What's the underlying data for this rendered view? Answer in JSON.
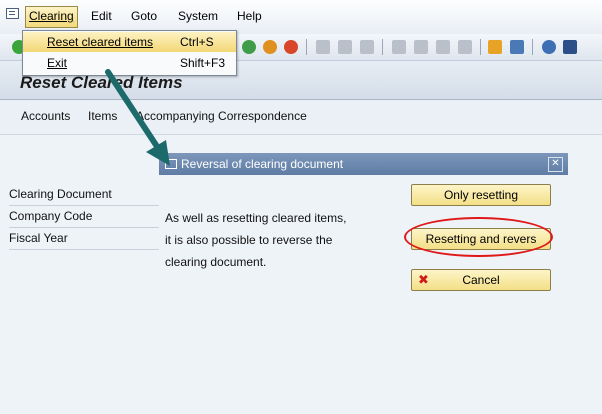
{
  "menubar": {
    "items": [
      {
        "label": "Clearing",
        "active": true
      },
      {
        "label": "Edit"
      },
      {
        "label": "Goto"
      },
      {
        "label": "System"
      },
      {
        "label": "Help"
      }
    ]
  },
  "dropdown": {
    "items": [
      {
        "label": "Reset cleared items",
        "shortcut": "Ctrl+S"
      },
      {
        "label": "Exit",
        "shortcut": "Shift+F3"
      }
    ]
  },
  "page": {
    "title": "Reset Cleared Items",
    "app_toolbar": [
      "Accounts",
      "Items",
      "Accompanying Correspondence"
    ]
  },
  "form": {
    "fields": [
      "Clearing Document",
      "Company Code",
      "Fiscal Year"
    ]
  },
  "dialog": {
    "title": "Reversal of clearing document",
    "close": "✕",
    "text": "As well as resetting cleared items, it is also possible to reverse the clearing document.",
    "buttons": {
      "only_resetting": "Only resetting",
      "resetting_reverse": "Resetting and revers",
      "cancel": "Cancel"
    }
  },
  "colors": {
    "highlight_ellipse": "#e01818",
    "arrow": "#1d6a6a"
  }
}
